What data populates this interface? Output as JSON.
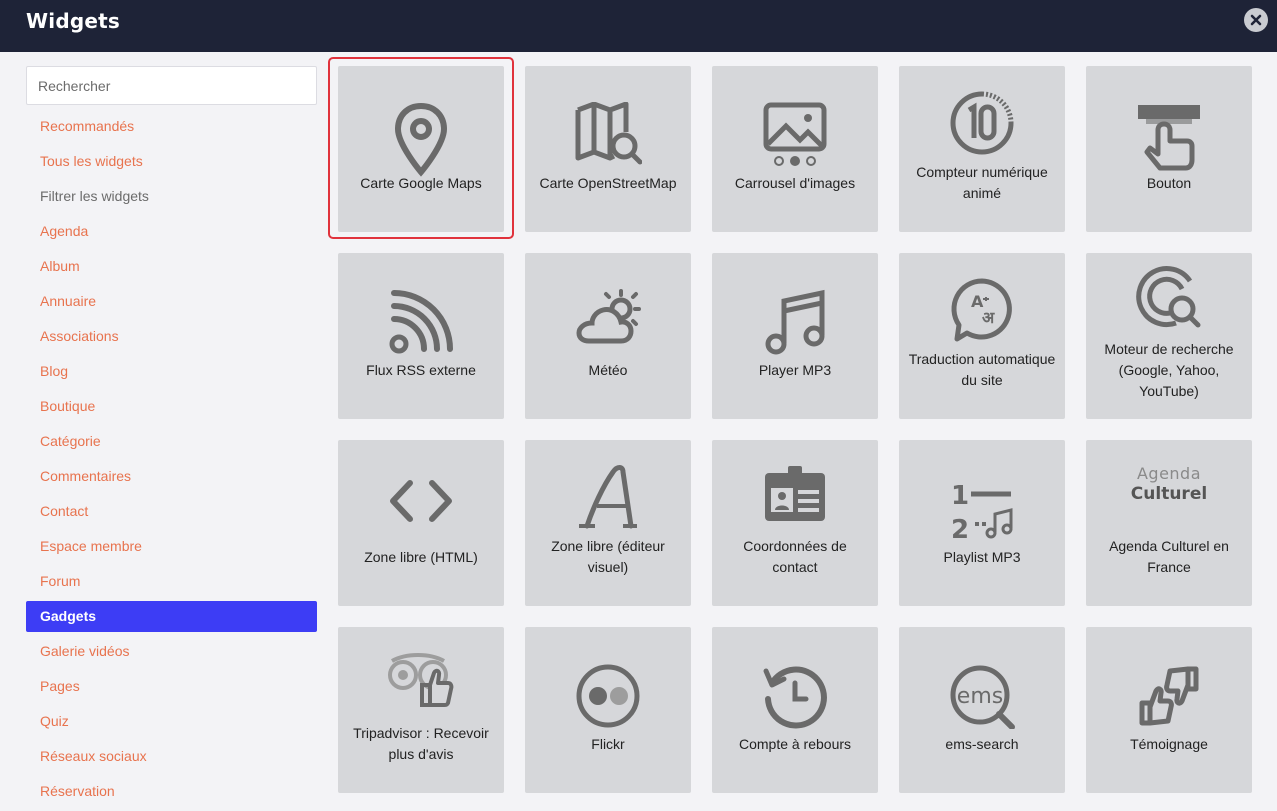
{
  "header": {
    "title": "Widgets",
    "close_icon": "close-icon"
  },
  "search": {
    "placeholder": "Rechercher",
    "value": ""
  },
  "categories": [
    {
      "label": "Recommandés",
      "state": "normal"
    },
    {
      "label": "Tous les widgets",
      "state": "normal"
    },
    {
      "label": "Filtrer les widgets",
      "state": "muted"
    },
    {
      "label": "Agenda",
      "state": "normal"
    },
    {
      "label": "Album",
      "state": "normal"
    },
    {
      "label": "Annuaire",
      "state": "normal"
    },
    {
      "label": "Associations",
      "state": "normal"
    },
    {
      "label": "Blog",
      "state": "normal"
    },
    {
      "label": "Boutique",
      "state": "normal"
    },
    {
      "label": "Catégorie",
      "state": "normal"
    },
    {
      "label": "Commentaires",
      "state": "normal"
    },
    {
      "label": "Contact",
      "state": "normal"
    },
    {
      "label": "Espace membre",
      "state": "normal"
    },
    {
      "label": "Forum",
      "state": "normal"
    },
    {
      "label": "Gadgets",
      "state": "active"
    },
    {
      "label": "Galerie vidéos",
      "state": "normal"
    },
    {
      "label": "Pages",
      "state": "normal"
    },
    {
      "label": "Quiz",
      "state": "normal"
    },
    {
      "label": "Réseaux sociaux",
      "state": "normal"
    },
    {
      "label": "Réservation",
      "state": "normal"
    }
  ],
  "widgets": [
    {
      "label": "Carte Google Maps",
      "icon": "map-pin-icon",
      "selected": true
    },
    {
      "label": "Carte OpenStreetMap",
      "icon": "map-search-icon"
    },
    {
      "label": "Carrousel d'images",
      "icon": "image-carousel-icon"
    },
    {
      "label": "Compteur numérique animé",
      "icon": "counter-icon"
    },
    {
      "label": "Bouton",
      "icon": "button-click-icon"
    },
    {
      "label": "Flux RSS externe",
      "icon": "rss-icon"
    },
    {
      "label": "Météo",
      "icon": "weather-icon"
    },
    {
      "label": "Player MP3",
      "icon": "music-note-icon"
    },
    {
      "label": "Traduction automatique du site",
      "icon": "translate-icon"
    },
    {
      "label": "Moteur de recherche (Google, Yahoo, YouTube)",
      "icon": "search-engine-icon"
    },
    {
      "label": "Zone libre (HTML)",
      "icon": "code-icon"
    },
    {
      "label": "Zone libre (éditeur visuel)",
      "icon": "font-a-icon"
    },
    {
      "label": "Coordonnées de contact",
      "icon": "contact-card-icon"
    },
    {
      "label": "Playlist MP3",
      "icon": "playlist-icon"
    },
    {
      "label": "Agenda Culturel en France",
      "icon": "agenda-culturel-logo",
      "logo_text": [
        "Agenda",
        "Culturel"
      ]
    },
    {
      "label": "Tripadvisor : Recevoir plus d'avis",
      "icon": "tripadvisor-icon"
    },
    {
      "label": "Flickr",
      "icon": "flickr-icon"
    },
    {
      "label": "Compte à rebours",
      "icon": "countdown-icon"
    },
    {
      "label": "ems-search",
      "icon": "ems-search-icon",
      "logo_text": "ems"
    },
    {
      "label": "Témoignage",
      "icon": "testimonial-icon"
    }
  ],
  "colors": {
    "header_bg": "#1e2337",
    "accent": "#3d3df5",
    "link": "#e8734e",
    "tile_bg": "#d6d7da",
    "icon": "#6a6a6a",
    "selection": "#e0323c"
  }
}
